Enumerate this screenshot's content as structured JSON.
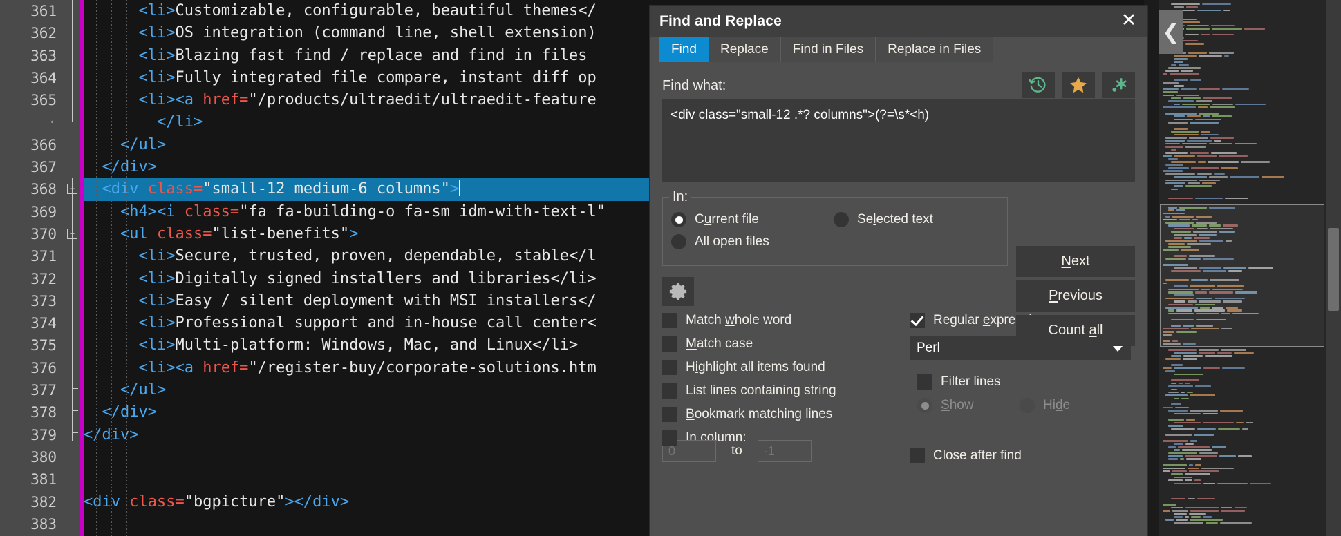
{
  "editor": {
    "lines": [
      {
        "num": "361",
        "indent": 4,
        "fold": null,
        "parts": [
          {
            "t": "tag",
            "s": "<li>"
          },
          {
            "t": "txt",
            "s": "Customizable, configurable, beautiful themes</"
          }
        ]
      },
      {
        "num": "362",
        "indent": 4,
        "fold": null,
        "parts": [
          {
            "t": "tag",
            "s": "<li>"
          },
          {
            "t": "txt",
            "s": "OS integration (command line, shell extension)"
          }
        ]
      },
      {
        "num": "363",
        "indent": 4,
        "fold": null,
        "parts": [
          {
            "t": "tag",
            "s": "<li>"
          },
          {
            "t": "txt",
            "s": "Blazing fast find / replace and find in files "
          }
        ]
      },
      {
        "num": "364",
        "indent": 4,
        "fold": null,
        "parts": [
          {
            "t": "tag",
            "s": "<li>"
          },
          {
            "t": "txt",
            "s": "Fully integrated file compare, instant diff op"
          }
        ]
      },
      {
        "num": "365",
        "indent": 4,
        "fold": null,
        "parts": [
          {
            "t": "tag",
            "s": "<li><a "
          },
          {
            "t": "attr",
            "s": "href="
          },
          {
            "t": "txt",
            "s": "\"/products/ultraedit/ultraedit-feature"
          }
        ]
      },
      {
        "num": "·",
        "indent": 5,
        "fold": null,
        "parts": [
          {
            "t": "tag",
            "s": "</li>"
          }
        ]
      },
      {
        "num": "366",
        "indent": 3,
        "fold": null,
        "parts": [
          {
            "t": "tag",
            "s": "</ul>"
          }
        ]
      },
      {
        "num": "367",
        "indent": 2,
        "fold": null,
        "parts": [
          {
            "t": "tag",
            "s": "</div>"
          }
        ]
      },
      {
        "num": "368",
        "indent": 2,
        "fold": "minus",
        "selected": true,
        "cursor": true,
        "parts": [
          {
            "t": "tag",
            "s": "<div "
          },
          {
            "t": "attr",
            "s": "class="
          },
          {
            "t": "txt",
            "s": "\"small-12 medium-6 columns\""
          },
          {
            "t": "tag",
            "s": ">"
          }
        ]
      },
      {
        "num": "369",
        "indent": 3,
        "fold": null,
        "parts": [
          {
            "t": "tag",
            "s": "<h4><i "
          },
          {
            "t": "attr",
            "s": "class="
          },
          {
            "t": "txt",
            "s": "\"fa fa-building-o fa-sm idm-with-text-l\""
          }
        ]
      },
      {
        "num": "370",
        "indent": 3,
        "fold": "minus",
        "parts": [
          {
            "t": "tag",
            "s": "<ul "
          },
          {
            "t": "attr",
            "s": "class="
          },
          {
            "t": "txt",
            "s": "\"list-benefits\""
          },
          {
            "t": "tag",
            "s": ">"
          }
        ]
      },
      {
        "num": "371",
        "indent": 4,
        "fold": null,
        "parts": [
          {
            "t": "tag",
            "s": "<li>"
          },
          {
            "t": "txt",
            "s": "Secure, trusted, proven, dependable, stable</l"
          }
        ]
      },
      {
        "num": "372",
        "indent": 4,
        "fold": null,
        "parts": [
          {
            "t": "tag",
            "s": "<li>"
          },
          {
            "t": "txt",
            "s": "Digitally signed installers and libraries</li>"
          }
        ]
      },
      {
        "num": "373",
        "indent": 4,
        "fold": null,
        "parts": [
          {
            "t": "tag",
            "s": "<li>"
          },
          {
            "t": "txt",
            "s": "Easy / silent deployment with MSI installers</"
          }
        ]
      },
      {
        "num": "374",
        "indent": 4,
        "fold": null,
        "parts": [
          {
            "t": "tag",
            "s": "<li>"
          },
          {
            "t": "txt",
            "s": "Professional support and in-house call center<"
          }
        ]
      },
      {
        "num": "375",
        "indent": 4,
        "fold": null,
        "parts": [
          {
            "t": "tag",
            "s": "<li>"
          },
          {
            "t": "txt",
            "s": "Multi-platform: Windows, Mac, and Linux</li>"
          }
        ]
      },
      {
        "num": "376",
        "indent": 4,
        "fold": null,
        "parts": [
          {
            "t": "tag",
            "s": "<li><a "
          },
          {
            "t": "attr",
            "s": "href="
          },
          {
            "t": "txt",
            "s": "\"/register-buy/corporate-solutions.htm"
          }
        ]
      },
      {
        "num": "377",
        "indent": 3,
        "fold": null,
        "parts": [
          {
            "t": "tag",
            "s": "</ul>"
          }
        ]
      },
      {
        "num": "378",
        "indent": 2,
        "fold": null,
        "parts": [
          {
            "t": "tag",
            "s": "</div>"
          }
        ]
      },
      {
        "num": "379",
        "indent": 1,
        "fold": null,
        "parts": [
          {
            "t": "tag",
            "s": "</div>"
          }
        ]
      },
      {
        "num": "380",
        "indent": 1,
        "fold": null,
        "parts": []
      },
      {
        "num": "381",
        "indent": 1,
        "fold": null,
        "parts": []
      },
      {
        "num": "382",
        "indent": 1,
        "fold": null,
        "parts": [
          {
            "t": "tag",
            "s": "<div "
          },
          {
            "t": "attr",
            "s": "class="
          },
          {
            "t": "txt",
            "s": "\"bgpicture\""
          },
          {
            "t": "tag",
            "s": "></div>"
          }
        ]
      },
      {
        "num": "383",
        "indent": 1,
        "fold": null,
        "parts": []
      }
    ],
    "colors": {
      "background": "#151515",
      "gutter": "#4a4a4a",
      "line_number": "#cfcfcf",
      "tag": "#4aa8ef",
      "attribute": "#f0554a",
      "text": "#e8e8e8",
      "selection": "#1177aa",
      "change_bar": "#c800c8"
    }
  },
  "minimap": {
    "name": "code-minimap",
    "back_button_icon": "chevron-left-icon"
  },
  "dialog": {
    "title": "Find and Replace",
    "close_icon": "close-icon",
    "tabs": [
      {
        "label": "Find",
        "active": true
      },
      {
        "label": "Replace",
        "active": false
      },
      {
        "label": "Find in Files",
        "active": false
      },
      {
        "label": "Replace in Files",
        "active": false
      }
    ],
    "toolbar": [
      {
        "name": "history-icon",
        "glyph": "history",
        "color": "#5cb88a"
      },
      {
        "name": "favorites-star-icon",
        "glyph": "star",
        "color": "#e8a94b"
      },
      {
        "name": "regex-icon",
        "glyph": "regex",
        "color": "#5cb88a"
      }
    ],
    "find_what_label": "Find what:",
    "find_what_value": "<div class=\"small-12 .*? columns\">(?=\\s*<h)",
    "in_group": {
      "legend": "In:",
      "options": [
        {
          "label": "Current file",
          "mnemonic": "u",
          "selected": true,
          "disabled": false
        },
        {
          "label": "Selected text",
          "mnemonic": "l",
          "selected": false,
          "disabled": false
        },
        {
          "label": "All open files",
          "mnemonic": "o",
          "selected": false,
          "disabled": false
        }
      ]
    },
    "gear_icon": "gear-icon",
    "options_left": [
      {
        "label": "Match whole word",
        "mnemonic": "w",
        "checked": false
      },
      {
        "label": "Match case",
        "mnemonic": "M",
        "checked": false
      },
      {
        "label": "Highlight all items found",
        "mnemonic": "i",
        "checked": false
      },
      {
        "label": "List lines containing string",
        "mnemonic": "g",
        "checked": false
      },
      {
        "label": "Bookmark matching lines",
        "mnemonic": "B",
        "checked": false
      },
      {
        "label": "In column:",
        "mnemonic": "",
        "checked": false
      }
    ],
    "column_range": {
      "from_value": "",
      "from_placeholder": "0",
      "to_label": "to",
      "to_value": "",
      "to_placeholder": "-1"
    },
    "regex": {
      "label": "Regular expressions:",
      "mnemonic": "e",
      "checked": true,
      "engine_selected": "Perl"
    },
    "filter_lines": {
      "label": "Filter lines",
      "checked": false,
      "show_label": "Show",
      "show_mnemonic": "S",
      "hide_label": "Hide",
      "hide_mnemonic": "d",
      "selected": "Show",
      "disabled": true
    },
    "close_after_find": {
      "label": "Close after find",
      "mnemonic": "C",
      "checked": false
    },
    "buttons": [
      {
        "label": "Next",
        "mnemonic": "N"
      },
      {
        "label": "Previous",
        "mnemonic": "P"
      },
      {
        "label": "Count all",
        "mnemonic": "a"
      }
    ],
    "colors": {
      "dialog_bg": "#4f4f4f",
      "title_bg": "#3f3f3f",
      "tab_active": "#0d8bd0",
      "control_bg": "#3a3a3a",
      "text": "#f2efe9",
      "disabled_text": "#8d8d8d"
    }
  }
}
